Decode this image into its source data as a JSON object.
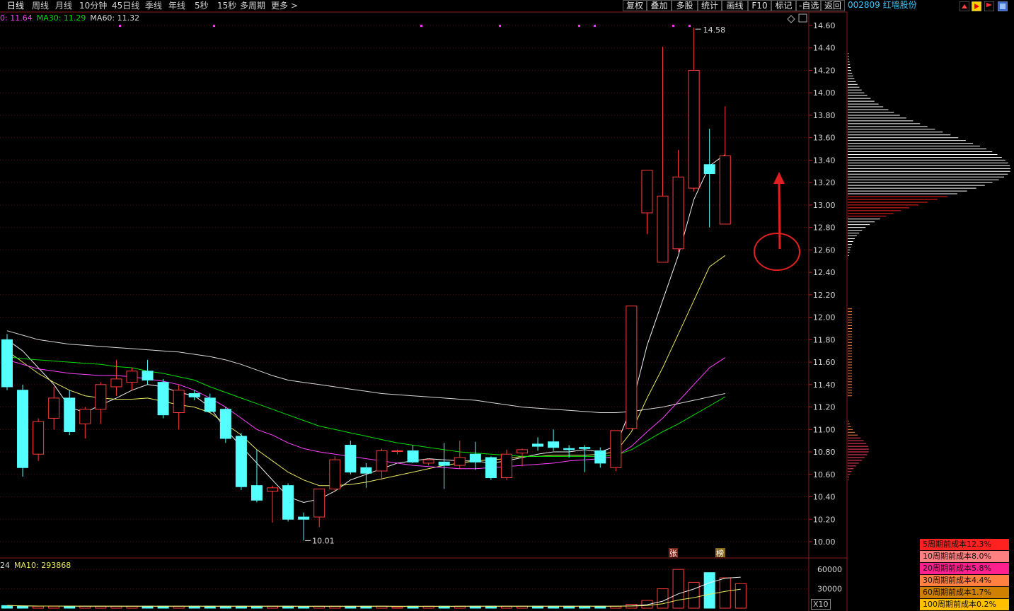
{
  "toolbar": {
    "period_tabs": [
      {
        "label": "日线",
        "active": true
      },
      {
        "label": "周线",
        "active": false
      },
      {
        "label": "月线",
        "active": false
      },
      {
        "label": "10分钟",
        "active": false
      },
      {
        "label": "45日线",
        "active": false
      },
      {
        "label": "季线",
        "active": false
      },
      {
        "label": "年线",
        "active": false
      },
      {
        "label": "5秒",
        "active": false
      },
      {
        "label": "15秒",
        "active": false
      },
      {
        "label": "多周期",
        "active": false
      },
      {
        "label": "更多",
        "active": false
      }
    ],
    "right_buttons": [
      "复权",
      "叠加",
      "多股",
      "统计",
      "画线",
      "F10",
      "标记",
      "-自选",
      "返回"
    ],
    "stock": "002809 红墙股份"
  },
  "ma_legend": [
    {
      "text": "0: 11.64",
      "color": "#ff40ff"
    },
    {
      "text": "MA30: 11.29",
      "color": "#00e000"
    },
    {
      "text": "MA60: 11.32",
      "color": "#d8d8d8"
    }
  ],
  "volume_legend": [
    {
      "text": "24",
      "color": "#d8d8d8"
    },
    {
      "text": "MA10: 293868",
      "color": "#e8e860"
    }
  ],
  "volume_multiplier": "X10",
  "price_axis": [
    "14.60",
    "14.40",
    "14.20",
    "14.00",
    "13.80",
    "13.60",
    "13.40",
    "13.20",
    "13.00",
    "12.80",
    "12.60",
    "12.40",
    "12.20",
    "12.00",
    "11.80",
    "11.60",
    "11.40",
    "11.20",
    "11.00",
    "10.80",
    "10.60",
    "10.40",
    "10.20",
    "10.00"
  ],
  "volume_axis": [
    "60000",
    "30000"
  ],
  "annotations": {
    "high": "14.58",
    "low": "10.01",
    "limit_up_marker": "张",
    "dragon_marker": "榜"
  },
  "cost_distribution": [
    {
      "label": "5周期前成本12.3%",
      "color": "#ff2020"
    },
    {
      "label": "10周期前成本8.0%",
      "color": "#ff8080"
    },
    {
      "label": "20周期前成本5.8%",
      "color": "#ff2090"
    },
    {
      "label": "30周期前成本4.4%",
      "color": "#ff8040"
    },
    {
      "label": "60周期前成本1.7%",
      "color": "#d08000"
    },
    {
      "label": "100周期前成本0.2%",
      "color": "#ffc000"
    }
  ],
  "chart_data": {
    "type": "candlestick",
    "y_axis_range": [
      10.0,
      14.6
    ],
    "candles": [
      {
        "o": 11.8,
        "h": 11.85,
        "l": 11.35,
        "c": 11.38
      },
      {
        "o": 11.35,
        "h": 11.4,
        "l": 10.58,
        "c": 10.66
      },
      {
        "o": 10.78,
        "h": 11.1,
        "l": 10.72,
        "c": 11.07
      },
      {
        "o": 11.1,
        "h": 11.38,
        "l": 11.0,
        "c": 11.28
      },
      {
        "o": 11.28,
        "h": 11.35,
        "l": 10.95,
        "c": 10.98
      },
      {
        "o": 11.05,
        "h": 11.2,
        "l": 10.92,
        "c": 11.18
      },
      {
        "o": 11.18,
        "h": 11.42,
        "l": 11.05,
        "c": 11.4
      },
      {
        "o": 11.38,
        "h": 11.62,
        "l": 11.3,
        "c": 11.45
      },
      {
        "o": 11.42,
        "h": 11.55,
        "l": 11.35,
        "c": 11.52
      },
      {
        "o": 11.52,
        "h": 11.62,
        "l": 11.4,
        "c": 11.44
      },
      {
        "o": 11.42,
        "h": 11.45,
        "l": 11.1,
        "c": 11.13
      },
      {
        "o": 11.15,
        "h": 11.4,
        "l": 11.0,
        "c": 11.35
      },
      {
        "o": 11.32,
        "h": 11.35,
        "l": 11.26,
        "c": 11.29
      },
      {
        "o": 11.28,
        "h": 11.32,
        "l": 11.15,
        "c": 11.16
      },
      {
        "o": 11.18,
        "h": 11.2,
        "l": 10.88,
        "c": 10.92
      },
      {
        "o": 10.94,
        "h": 10.97,
        "l": 10.46,
        "c": 10.49
      },
      {
        "o": 10.5,
        "h": 10.82,
        "l": 10.35,
        "c": 10.37
      },
      {
        "o": 10.45,
        "h": 10.5,
        "l": 10.17,
        "c": 10.48
      },
      {
        "o": 10.5,
        "h": 10.52,
        "l": 10.18,
        "c": 10.2
      },
      {
        "o": 10.22,
        "h": 10.26,
        "l": 10.01,
        "c": 10.2
      },
      {
        "o": 10.22,
        "h": 10.45,
        "l": 10.13,
        "c": 10.47
      },
      {
        "o": 10.47,
        "h": 10.76,
        "l": 10.44,
        "c": 10.73
      },
      {
        "o": 10.86,
        "h": 10.9,
        "l": 10.6,
        "c": 10.62
      },
      {
        "o": 10.66,
        "h": 10.7,
        "l": 10.48,
        "c": 10.61
      },
      {
        "o": 10.63,
        "h": 10.83,
        "l": 10.55,
        "c": 10.81
      },
      {
        "o": 10.81,
        "h": 10.82,
        "l": 10.78,
        "c": 10.81
      },
      {
        "o": 10.81,
        "h": 10.86,
        "l": 10.7,
        "c": 10.71
      },
      {
        "o": 10.7,
        "h": 10.74,
        "l": 10.68,
        "c": 10.73
      },
      {
        "o": 10.71,
        "h": 10.88,
        "l": 10.47,
        "c": 10.68
      },
      {
        "o": 10.68,
        "h": 10.9,
        "l": 10.65,
        "c": 10.75
      },
      {
        "o": 10.78,
        "h": 10.89,
        "l": 10.64,
        "c": 10.71
      },
      {
        "o": 10.75,
        "h": 10.76,
        "l": 10.55,
        "c": 10.57
      },
      {
        "o": 10.57,
        "h": 10.82,
        "l": 10.55,
        "c": 10.78
      },
      {
        "o": 10.79,
        "h": 10.83,
        "l": 10.67,
        "c": 10.82
      },
      {
        "o": 10.87,
        "h": 10.93,
        "l": 10.81,
        "c": 10.85
      },
      {
        "o": 10.89,
        "h": 11.0,
        "l": 10.81,
        "c": 10.84
      },
      {
        "o": 10.83,
        "h": 10.86,
        "l": 10.75,
        "c": 10.82
      },
      {
        "o": 10.84,
        "h": 10.86,
        "l": 10.62,
        "c": 10.83
      },
      {
        "o": 10.81,
        "h": 10.84,
        "l": 10.66,
        "c": 10.7
      },
      {
        "o": 10.66,
        "h": 10.99,
        "l": 10.63,
        "c": 10.99
      },
      {
        "o": 11.01,
        "h": 12.1,
        "l": 11.01,
        "c": 12.1
      },
      {
        "o": 12.93,
        "h": 13.31,
        "l": 12.74,
        "c": 13.31
      },
      {
        "o": 12.49,
        "h": 14.41,
        "l": 12.49,
        "c": 13.08
      },
      {
        "o": 12.61,
        "h": 13.49,
        "l": 12.58,
        "c": 13.25
      },
      {
        "o": 13.15,
        "h": 14.58,
        "l": 13.12,
        "c": 14.2
      },
      {
        "o": 13.36,
        "h": 13.68,
        "l": 12.8,
        "c": 13.28
      },
      {
        "o": 12.83,
        "h": 13.88,
        "l": 12.83,
        "c": 13.44
      }
    ],
    "volumes": [
      4,
      3,
      3,
      3,
      3,
      3,
      3,
      3,
      3,
      3,
      3,
      3,
      3,
      3,
      3,
      3,
      3,
      3,
      3,
      2,
      3,
      3,
      3,
      3,
      3,
      2,
      3,
      3,
      3,
      3,
      3,
      3,
      3,
      3,
      3,
      3,
      3,
      3,
      3,
      3,
      6,
      12,
      30,
      60,
      40,
      55,
      47,
      38
    ],
    "ma_lines": [
      {
        "name": "MA5",
        "color": "#f0f0f0",
        "values": [
          11.8,
          11.7,
          11.55,
          11.4,
          11.2,
          11.15,
          11.22,
          11.28,
          11.35,
          11.4,
          11.38,
          11.33,
          11.3,
          11.2,
          11.0,
          10.85,
          10.7,
          10.55,
          10.4,
          10.35,
          10.38,
          10.45,
          10.55,
          10.6,
          10.65,
          10.7,
          10.72,
          10.74,
          10.73,
          10.72,
          10.72,
          10.7,
          10.72,
          10.75,
          10.78,
          10.8,
          10.8,
          10.82,
          10.8,
          10.85,
          11.2,
          11.75,
          12.15,
          12.55,
          13.05,
          13.35,
          13.45
        ]
      },
      {
        "name": "MA10",
        "color": "#e8e860",
        "values": [
          11.7,
          11.6,
          11.5,
          11.42,
          11.35,
          11.3,
          11.28,
          11.27,
          11.27,
          11.28,
          11.25,
          11.22,
          11.2,
          11.15,
          11.05,
          10.95,
          10.82,
          10.72,
          10.62,
          10.55,
          10.5,
          10.5,
          10.51,
          10.53,
          10.56,
          10.59,
          10.62,
          10.65,
          10.68,
          10.7,
          10.72,
          10.73,
          10.74,
          10.76,
          10.76,
          10.77,
          10.77,
          10.77,
          10.78,
          10.8,
          10.98,
          11.28,
          11.55,
          11.85,
          12.15,
          12.45,
          12.55
        ]
      },
      {
        "name": "MA20",
        "color": "#ff40ff",
        "values": [
          11.62,
          11.58,
          11.54,
          11.52,
          11.5,
          11.49,
          11.48,
          11.48,
          11.47,
          11.45,
          11.43,
          11.4,
          11.35,
          11.28,
          11.2,
          11.1,
          11.0,
          10.95,
          10.88,
          10.83,
          10.8,
          10.78,
          10.76,
          10.74,
          10.72,
          10.7,
          10.68,
          10.67,
          10.66,
          10.65,
          10.65,
          10.66,
          10.67,
          10.68,
          10.69,
          10.7,
          10.72,
          10.73,
          10.74,
          10.76,
          10.85,
          10.98,
          11.1,
          11.25,
          11.4,
          11.55,
          11.64
        ]
      },
      {
        "name": "MA30",
        "color": "#00e000",
        "values": [
          11.65,
          11.63,
          11.62,
          11.61,
          11.6,
          11.59,
          11.58,
          11.56,
          11.55,
          11.52,
          11.5,
          11.47,
          11.44,
          11.38,
          11.33,
          11.28,
          11.23,
          11.18,
          11.13,
          11.08,
          11.03,
          11.0,
          10.97,
          10.94,
          10.91,
          10.88,
          10.86,
          10.84,
          10.82,
          10.8,
          10.79,
          10.78,
          10.77,
          10.76,
          10.76,
          10.76,
          10.76,
          10.76,
          10.76,
          10.77,
          10.82,
          10.9,
          10.98,
          11.05,
          11.13,
          11.21,
          11.29
        ]
      },
      {
        "name": "MA60",
        "color": "#d8d8d8",
        "values": [
          11.88,
          11.84,
          11.8,
          11.78,
          11.76,
          11.75,
          11.74,
          11.73,
          11.72,
          11.71,
          11.7,
          11.69,
          11.67,
          11.65,
          11.62,
          11.58,
          11.53,
          11.48,
          11.44,
          11.42,
          11.4,
          11.38,
          11.36,
          11.34,
          11.32,
          11.31,
          11.3,
          11.29,
          11.28,
          11.27,
          11.26,
          11.24,
          11.22,
          11.2,
          11.19,
          11.18,
          11.17,
          11.16,
          11.15,
          11.15,
          11.16,
          11.18,
          11.2,
          11.23,
          11.26,
          11.29,
          11.32
        ]
      }
    ]
  }
}
